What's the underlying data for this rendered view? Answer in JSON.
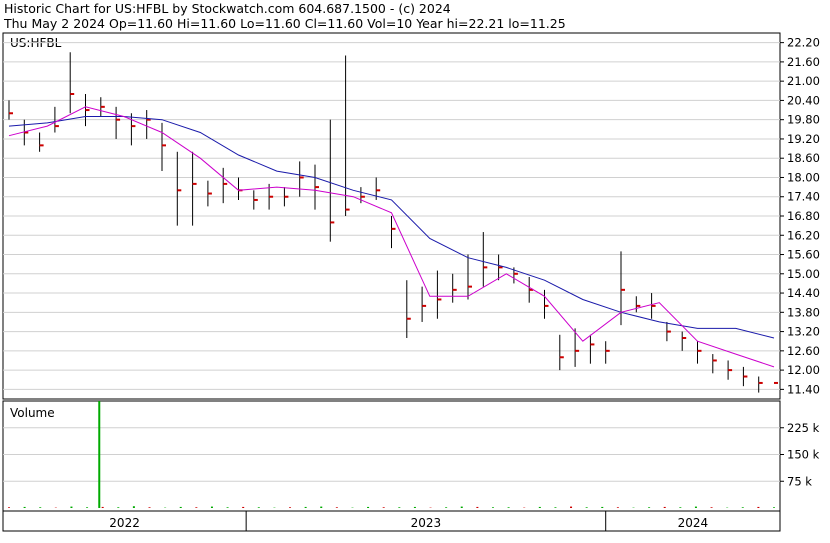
{
  "header": {
    "line1": "Historic Chart for US:HFBL by Stockwatch.com 604.687.1500 - (c) 2024",
    "line2": "Thu May  2 2024   Op=11.60   Hi=11.60   Lo=11.60   Cl=11.60   Vol=10   Year hi=22.21   lo=11.25"
  },
  "price_panel": {
    "symbol_label": "US:HFBL"
  },
  "volume_panel": {
    "label": "Volume"
  },
  "colors": {
    "price_bar": "#000000",
    "close_tick": "#cc0000",
    "ma_short": "#cc00cc",
    "ma_long": "#1a1aaa",
    "volume_up": "#00aa00",
    "volume_down": "#cc0000"
  },
  "chart_data": [
    {
      "type": "line",
      "title": "Historic Chart for US:HFBL",
      "ylim": [
        11.1,
        22.5
      ],
      "y_ticks": [
        "22.20",
        "21.60",
        "21.00",
        "20.40",
        "19.80",
        "19.20",
        "18.60",
        "18.00",
        "17.40",
        "16.80",
        "16.20",
        "15.60",
        "15.00",
        "14.40",
        "13.80",
        "13.20",
        "12.60",
        "12.00",
        "11.40"
      ],
      "x_ticks": [
        "2022",
        "2023",
        "2024"
      ],
      "x_period_ends": [
        0.31,
        0.78
      ],
      "series": [
        {
          "kind": "price",
          "x": [
            0.0,
            0.02,
            0.04,
            0.06,
            0.08,
            0.1,
            0.12,
            0.14,
            0.16,
            0.18,
            0.2,
            0.22,
            0.24,
            0.26,
            0.28,
            0.3,
            0.32,
            0.34,
            0.36,
            0.38,
            0.4,
            0.42,
            0.44,
            0.46,
            0.48,
            0.5,
            0.52,
            0.54,
            0.56,
            0.58,
            0.6,
            0.62,
            0.64,
            0.66,
            0.68,
            0.7,
            0.72,
            0.74,
            0.76,
            0.78,
            0.8,
            0.82,
            0.84,
            0.86,
            0.88,
            0.9,
            0.92,
            0.94,
            0.96,
            0.98,
            1.0
          ],
          "close": [
            20.0,
            19.4,
            19.0,
            19.6,
            20.6,
            20.1,
            20.2,
            19.8,
            19.6,
            19.8,
            19.0,
            17.6,
            17.8,
            17.5,
            17.8,
            17.6,
            17.3,
            17.4,
            17.4,
            18.0,
            17.7,
            16.6,
            17.0,
            17.4,
            17.6,
            16.4,
            13.6,
            14.0,
            14.2,
            14.5,
            14.6,
            15.2,
            15.2,
            15.0,
            14.5,
            14.0,
            12.4,
            12.6,
            12.8,
            12.6,
            14.5,
            14.0,
            14.0,
            13.2,
            13.0,
            12.6,
            12.3,
            12.0,
            11.8,
            11.6,
            11.6
          ],
          "high": [
            20.4,
            19.8,
            19.4,
            20.2,
            21.9,
            20.6,
            20.5,
            20.2,
            20.0,
            20.1,
            19.7,
            18.8,
            18.8,
            17.9,
            18.3,
            18.0,
            17.6,
            17.8,
            17.7,
            18.5,
            18.4,
            19.8,
            21.8,
            17.7,
            18.0,
            16.8,
            14.8,
            14.6,
            15.1,
            15.0,
            15.6,
            16.3,
            15.6,
            15.2,
            14.9,
            14.5,
            13.1,
            13.3,
            13.1,
            12.9,
            15.7,
            14.3,
            14.4,
            13.5,
            13.2,
            12.9,
            12.5,
            12.3,
            12.1,
            11.8,
            11.6
          ],
          "low": [
            19.8,
            19.0,
            18.8,
            19.4,
            20.0,
            19.6,
            19.9,
            19.2,
            19.0,
            19.2,
            18.2,
            16.5,
            16.5,
            17.1,
            17.2,
            17.3,
            17.0,
            17.0,
            17.1,
            17.4,
            17.0,
            16.0,
            16.8,
            17.2,
            17.3,
            15.8,
            13.0,
            13.5,
            13.6,
            14.1,
            14.2,
            14.6,
            14.8,
            14.7,
            14.1,
            13.6,
            12.0,
            12.1,
            12.2,
            12.2,
            13.4,
            13.8,
            13.6,
            12.9,
            12.6,
            12.2,
            11.9,
            11.7,
            11.5,
            11.3,
            11.6
          ]
        },
        {
          "kind": "ma_short",
          "x": [
            0.0,
            0.05,
            0.1,
            0.15,
            0.2,
            0.25,
            0.3,
            0.35,
            0.4,
            0.45,
            0.5,
            0.55,
            0.6,
            0.65,
            0.7,
            0.75,
            0.8,
            0.85,
            0.9,
            0.95,
            1.0
          ],
          "values": [
            19.3,
            19.6,
            20.2,
            19.9,
            19.4,
            18.6,
            17.6,
            17.7,
            17.6,
            17.4,
            16.9,
            14.3,
            14.3,
            15.0,
            14.3,
            12.9,
            13.8,
            14.1,
            12.9,
            12.5,
            12.1
          ]
        },
        {
          "kind": "ma_long",
          "x": [
            0.0,
            0.05,
            0.1,
            0.15,
            0.2,
            0.25,
            0.3,
            0.35,
            0.4,
            0.45,
            0.5,
            0.55,
            0.6,
            0.65,
            0.7,
            0.75,
            0.8,
            0.85,
            0.9,
            0.95,
            1.0
          ],
          "values": [
            19.6,
            19.7,
            19.9,
            19.9,
            19.8,
            19.4,
            18.7,
            18.2,
            18.0,
            17.6,
            17.3,
            16.1,
            15.5,
            15.2,
            14.8,
            14.2,
            13.8,
            13.5,
            13.3,
            13.3,
            13.0
          ]
        }
      ]
    },
    {
      "type": "bar",
      "title": "Volume",
      "y_ticks": [
        "225 k",
        "150 k",
        "75 k"
      ],
      "ylim": [
        0,
        300
      ],
      "spike": {
        "x": 0.118,
        "value": 305
      },
      "baseline_values": [
        2,
        3,
        2,
        1,
        4,
        2,
        3,
        2,
        5,
        2,
        1,
        3,
        2,
        4,
        2,
        3,
        2,
        1,
        2,
        3,
        4,
        2,
        1,
        3,
        2,
        2,
        3,
        1,
        2,
        4,
        3,
        2,
        2,
        1,
        3,
        2,
        4,
        2,
        3,
        2,
        1,
        2,
        3,
        2,
        4,
        2,
        1,
        2,
        3,
        2
      ]
    }
  ]
}
